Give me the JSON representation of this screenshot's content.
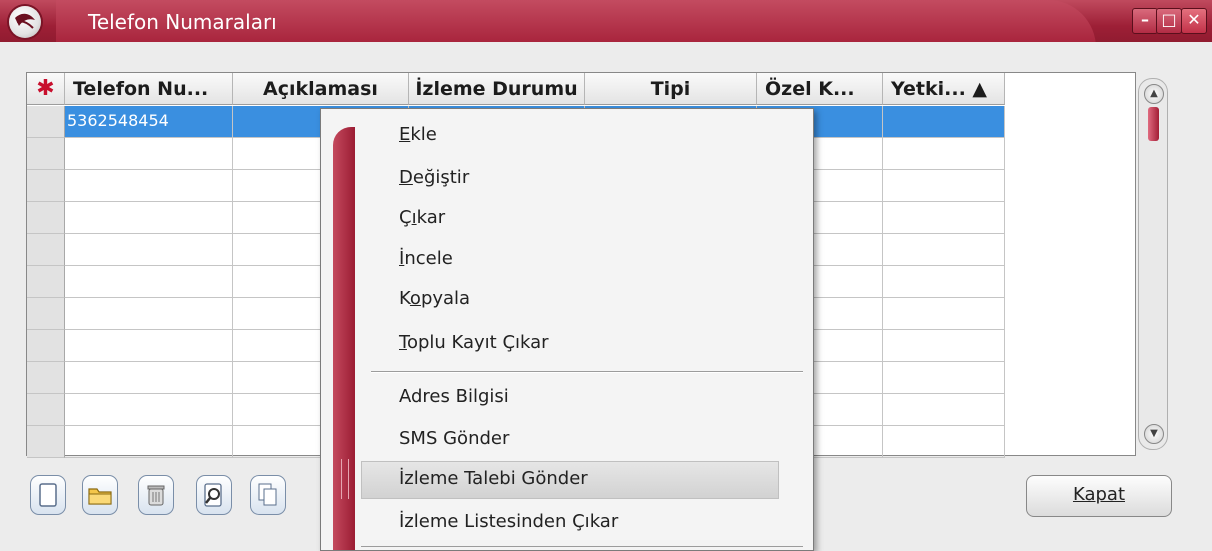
{
  "window": {
    "title": "Telefon Numaraları",
    "min_glyph": "–",
    "max_glyph": "□",
    "close_glyph": "✕"
  },
  "grid": {
    "corner_icon": "asterisk-icon",
    "columns": [
      "Telefon Nu...",
      "Açıklaması",
      "İzleme Durumu",
      "Tipi",
      "Özel K...",
      "Yetki... ▲"
    ],
    "rows": [
      [
        "5362548454",
        "",
        "",
        "",
        "",
        ""
      ],
      [
        "",
        "",
        "",
        "",
        "",
        ""
      ],
      [
        "",
        "",
        "",
        "",
        "",
        ""
      ],
      [
        "",
        "",
        "",
        "",
        "",
        ""
      ],
      [
        "",
        "",
        "",
        "",
        "",
        ""
      ],
      [
        "",
        "",
        "",
        "",
        "",
        ""
      ],
      [
        "",
        "",
        "",
        "",
        "",
        ""
      ],
      [
        "",
        "",
        "",
        "",
        "",
        ""
      ],
      [
        "",
        "",
        "",
        "",
        "",
        ""
      ],
      [
        "",
        "",
        "",
        "",
        "",
        ""
      ],
      [
        "",
        "",
        "",
        "",
        "",
        ""
      ]
    ],
    "selected_row": 0
  },
  "toolbar": {
    "buttons": [
      "new-record-icon",
      "open-folder-icon",
      "trash-icon",
      "inspect-icon",
      "copy-icon"
    ],
    "close_label": "Kapat"
  },
  "context_menu": {
    "group1": [
      {
        "mnemonic": "E",
        "rest": "kle"
      },
      {
        "mnemonic": "D",
        "rest": "eğiştir"
      },
      {
        "pre": "Ç",
        "mnemonic": "ı",
        "rest": "kar"
      },
      {
        "mnemonic": "İ",
        "rest": "ncele"
      },
      {
        "pre": "K",
        "mnemonic": "o",
        "rest": "pyala"
      },
      {
        "mnemonic": "T",
        "rest": "oplu Kayıt Çıkar"
      }
    ],
    "group2": [
      "Adres Bilgisi",
      "SMS Gönder",
      "İzleme Talebi Gönder",
      "İzleme Listesinden Çıkar"
    ],
    "highlighted": "İzleme Talebi Gönder"
  },
  "colors": {
    "title_bar": "#a52038",
    "selection": "#3a8fe0",
    "accent_band": "#9b1c33"
  }
}
